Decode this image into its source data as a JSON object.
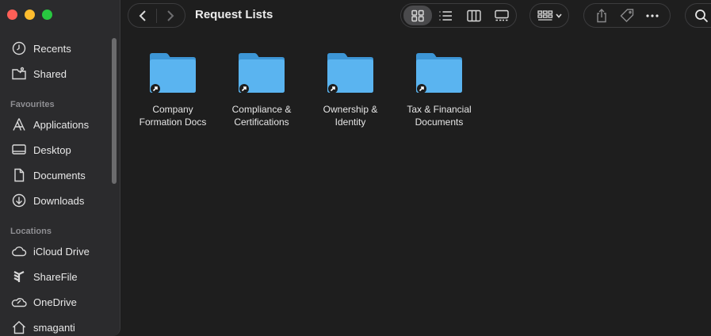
{
  "window": {
    "title": "Request Lists"
  },
  "sidebar": {
    "favorites_top": [
      {
        "label": "Recents",
        "icon": "clock-icon"
      },
      {
        "label": "Shared",
        "icon": "shared-folder-icon"
      }
    ],
    "favourites_heading": "Favourites",
    "favourites": [
      {
        "label": "Applications",
        "icon": "applications-icon"
      },
      {
        "label": "Desktop",
        "icon": "desktop-icon"
      },
      {
        "label": "Documents",
        "icon": "document-icon"
      },
      {
        "label": "Downloads",
        "icon": "download-icon"
      }
    ],
    "locations_heading": "Locations",
    "locations": [
      {
        "label": "iCloud Drive",
        "icon": "cloud-icon"
      },
      {
        "label": "ShareFile",
        "icon": "sharefile-icon"
      },
      {
        "label": "OneDrive",
        "icon": "onedrive-icon"
      },
      {
        "label": "smaganti",
        "icon": "home-icon"
      }
    ]
  },
  "toolbar": {
    "views": [
      "icon-view",
      "list-view",
      "column-view",
      "gallery-view"
    ],
    "active_view": "icon-view"
  },
  "folders": [
    {
      "label": "Company\nFormation Docs",
      "alias": true
    },
    {
      "label": "Compliance &\nCertifications",
      "alias": true
    },
    {
      "label": "Ownership &\nIdentity",
      "alias": true
    },
    {
      "label": "Tax & Financial\nDocuments",
      "alias": true
    }
  ],
  "colors": {
    "folder_blue": "#5ab4f0",
    "accent_close": "#ff5f57",
    "accent_minimize": "#febc2e",
    "accent_zoom": "#28c840"
  }
}
